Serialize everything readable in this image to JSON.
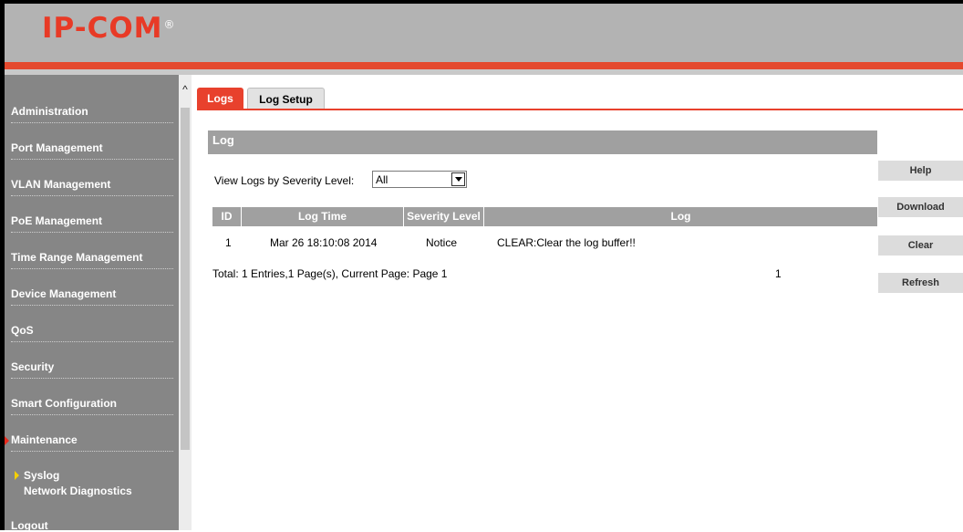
{
  "header": {
    "logo_text": "IP-COM",
    "logo_mark": "®"
  },
  "sidebar": {
    "items": [
      {
        "label": "Administration"
      },
      {
        "label": "Port Management"
      },
      {
        "label": "VLAN Management"
      },
      {
        "label": "PoE Management"
      },
      {
        "label": "Time Range Management"
      },
      {
        "label": "Device Management"
      },
      {
        "label": "QoS"
      },
      {
        "label": "Security"
      },
      {
        "label": "Smart Configuration"
      },
      {
        "label": "Maintenance"
      }
    ],
    "subitems": [
      {
        "label": "Syslog"
      },
      {
        "label": "Network Diagnostics"
      }
    ],
    "logout": "Logout",
    "active_item": "Maintenance",
    "active_subitem": "Syslog",
    "scroll_up_glyph": "^"
  },
  "tabs": [
    {
      "label": "Logs",
      "active": true
    },
    {
      "label": "Log Setup",
      "active": false
    }
  ],
  "panel": {
    "title": "Log",
    "filter_label": "View Logs by Severity Level:",
    "filter_value": "All"
  },
  "table": {
    "columns": [
      "ID",
      "Log Time",
      "Severity Level",
      "Log"
    ],
    "rows": [
      {
        "id": "1",
        "time": "Mar 26 18:10:08 2014",
        "severity": "Notice",
        "log": "CLEAR:Clear the log buffer!!"
      }
    ]
  },
  "footer": {
    "summary": "Total: 1 Entries,1 Page(s), Current Page: Page 1",
    "page_link": "1"
  },
  "buttons": {
    "help": "Help",
    "download": "Download",
    "clear": "Clear",
    "refresh": "Refresh"
  },
  "colors": {
    "brand_red": "#e8412d",
    "header_grey": "#b3b3b3",
    "sidebar_grey": "#868686",
    "table_header_grey": "#a0a0a0",
    "active_submenu_marker": "#f5d000"
  }
}
